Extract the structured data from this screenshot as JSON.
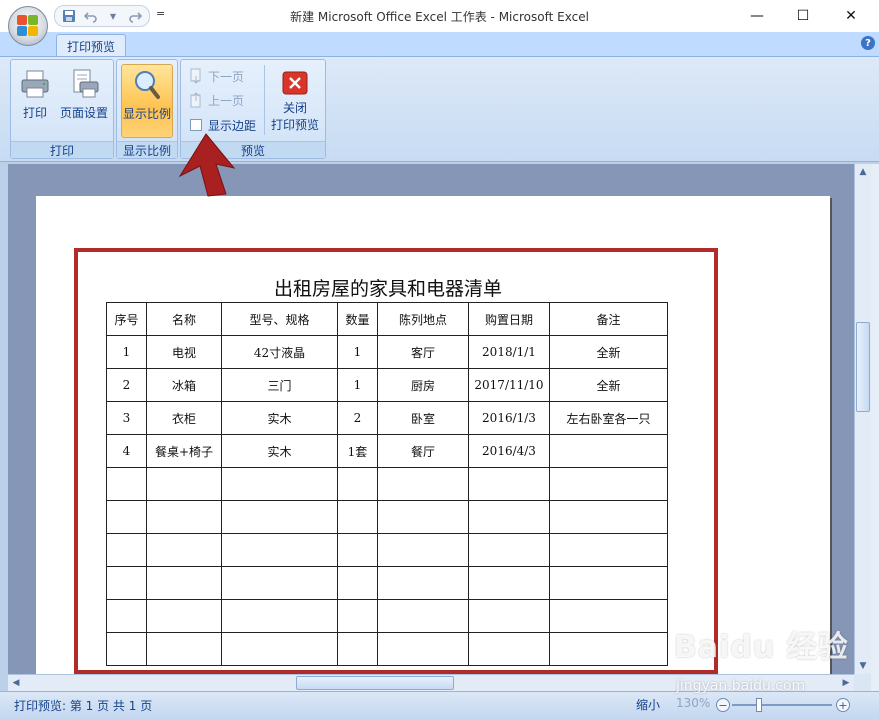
{
  "window": {
    "title": "新建 Microsoft Office Excel 工作表 - Microsoft Excel",
    "minimize_label": "—",
    "maximize_label": "☐",
    "close_label": "✕"
  },
  "quick_access": {
    "more_label": "="
  },
  "ribbon": {
    "tab": "打印预览",
    "groups": {
      "print": {
        "label": "打印",
        "print_button": "打印",
        "page_setup_button": "页面设置"
      },
      "zoom": {
        "label": "显示比例",
        "zoom_button": "显示比例"
      },
      "preview": {
        "label": "预览",
        "next_page": "下一页",
        "prev_page": "上一页",
        "show_margins": "显示边距",
        "show_margins_checked": false,
        "close_preview_line1": "关闭",
        "close_preview_line2": "打印预览"
      }
    }
  },
  "sheet": {
    "title": "出租房屋的家具和电器清单",
    "headers": [
      "序号",
      "名称",
      "型号、规格",
      "数量",
      "陈列地点",
      "购置日期",
      "备注"
    ],
    "rows": [
      [
        "1",
        "电视",
        "42寸液晶",
        "1",
        "客厅",
        "2018/1/1",
        "全新"
      ],
      [
        "2",
        "冰箱",
        "三门",
        "1",
        "厨房",
        "2017/11/10",
        "全新"
      ],
      [
        "3",
        "衣柜",
        "实木",
        "2",
        "卧室",
        "2016/1/3",
        "左右卧室各一只"
      ],
      [
        "4",
        "餐桌+椅子",
        "实木",
        "1套",
        "餐厅",
        "2016/4/3",
        ""
      ]
    ],
    "empty_rows": 6
  },
  "status_bar": {
    "text": "打印预览: 第 1 页 共 1 页",
    "zoom_out_label": "缩小",
    "zoom_percent": "130%",
    "zoom_minus": "−",
    "zoom_plus": "+"
  },
  "watermark": {
    "brand": "Baidu 经验",
    "site": "jingyan.baidu.com"
  },
  "colors": {
    "annotation_red": "#b22b2b",
    "ribbon_blue": "#15428b",
    "active_button": "#ffc24f"
  }
}
